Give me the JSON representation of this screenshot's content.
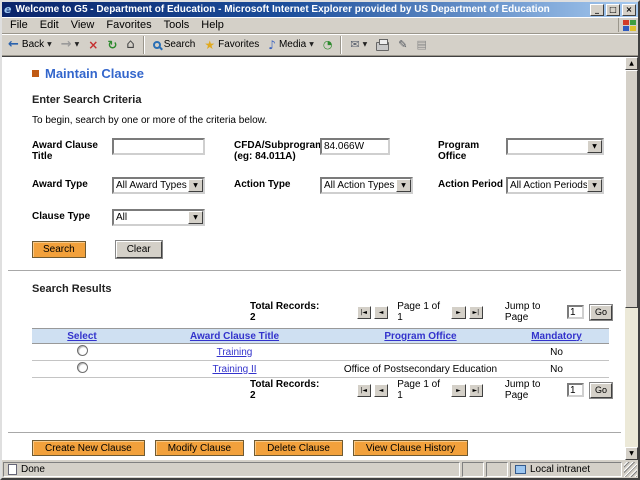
{
  "colors": {
    "accent_orange": "#F2A13C",
    "title_gradient_start": "#0A246A",
    "title_gradient_end": "#A6CAF0",
    "link_blue": "#3333CC",
    "table_header_bg": "#CFE0F2",
    "page_title_blue": "#3366CC"
  },
  "icons": {
    "ie_logo": "e",
    "minimize": "_",
    "maximize": "□",
    "close": "×",
    "back_arrow": "←",
    "forward_arrow": "→",
    "stop": "×",
    "refresh": "↻",
    "home": "⌂",
    "favorites_star": "★",
    "media_note": "♪",
    "history": "◔",
    "mail": "✉",
    "edit": "✎",
    "discuss": "▤",
    "dropdown": "▼",
    "scroll_up": "▲",
    "scroll_down": "▼",
    "pager_first": "|◄",
    "pager_prev": "◄",
    "pager_next": "►",
    "pager_last": "►|"
  },
  "window": {
    "title": "Welcome to G5 - Department of Education - Microsoft Internet Explorer provided by US Department of Education",
    "menu": {
      "items": [
        "File",
        "Edit",
        "View",
        "Favorites",
        "Tools",
        "Help"
      ]
    },
    "toolbar": {
      "back": "Back",
      "search": "Search",
      "favorites": "Favorites",
      "media": "Media"
    },
    "statusbar": {
      "status": "Done",
      "zone": "Local intranet"
    }
  },
  "page": {
    "title": "Maintain Clause",
    "criteria": {
      "heading": "Enter Search Criteria",
      "instructions": "To begin, search by one or more of the criteria below.",
      "award_clause_title_label": "Award Clause Title",
      "award_clause_title_value": "",
      "cfda_label": "CFDA/Subprogram",
      "cfda_label2": "(eg: 84.011A)",
      "cfda_value": "84.066W",
      "program_office_label": "Program Office",
      "program_office_value": "",
      "award_type_label": "Award Type",
      "award_type_value": "All Award Types",
      "action_type_label": "Action Type",
      "action_type_value": "All Action Types",
      "action_period_label": "Action Period",
      "action_period_value": "All Action Periods",
      "clause_type_label": "Clause Type",
      "clause_type_value": "All",
      "search_button": "Search",
      "clear_button": "Clear"
    },
    "results": {
      "heading": "Search Results",
      "total_records": "Total Records: 2",
      "page_info": "Page 1 of 1",
      "jump_label": "Jump to Page",
      "jump_value": "1",
      "go_button": "Go",
      "table": {
        "headers": [
          "Select",
          "Award Clause Title",
          "Program Office",
          "Mandatory"
        ],
        "rows": [
          {
            "title": "Training",
            "office": "",
            "mandatory": "No"
          },
          {
            "title": "Training II",
            "office": "Office of Postsecondary Education",
            "mandatory": "No"
          }
        ]
      }
    },
    "actions": [
      "Create New Clause",
      "Modify Clause",
      "Delete Clause",
      "View Clause History"
    ]
  }
}
